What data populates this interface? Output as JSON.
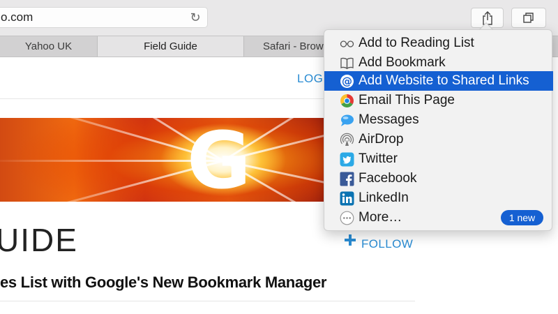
{
  "toolbar": {
    "url": "o.com",
    "reload_icon": "reload-icon",
    "share_icon": "share-icon",
    "tabs_icon": "tabs-overview-icon"
  },
  "tabs": [
    {
      "label": "Yahoo UK",
      "active": false
    },
    {
      "label": "Field Guide",
      "active": true
    },
    {
      "label": "Safari - Brow",
      "active": false
    }
  ],
  "page": {
    "login": "LOG I",
    "guide_title": "UIDE",
    "follow": "FOLLOW",
    "headline": "es List with Google's New Bookmark Manager",
    "banner_letter": "G"
  },
  "share_menu": {
    "items": [
      {
        "label": "Add to Reading List",
        "icon": "reading-glasses-icon"
      },
      {
        "label": "Add Bookmark",
        "icon": "book-icon"
      },
      {
        "label": "Add Website to Shared Links",
        "icon": "at-sign-icon",
        "highlighted": true
      },
      {
        "label": "Email This Page",
        "icon": "chrome-icon"
      },
      {
        "label": "Messages",
        "icon": "messages-icon"
      },
      {
        "label": "AirDrop",
        "icon": "airdrop-icon"
      },
      {
        "label": "Twitter",
        "icon": "twitter-icon"
      },
      {
        "label": "Facebook",
        "icon": "facebook-icon"
      },
      {
        "label": "LinkedIn",
        "icon": "linkedin-icon"
      },
      {
        "label": "More…",
        "icon": "more-icon"
      }
    ],
    "more_badge": "1 new"
  },
  "colors": {
    "accent": "#1560d2",
    "link": "#2a8cd3",
    "toolbar_bg": "#e9e8e9"
  }
}
